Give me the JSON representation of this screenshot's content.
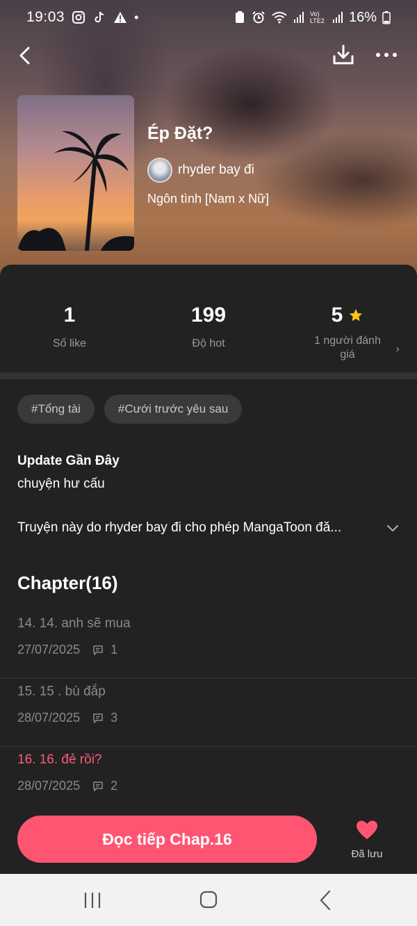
{
  "status_bar": {
    "time": "19:03",
    "battery": "16%",
    "network_label": "Vo) LTE2"
  },
  "book": {
    "title": "Ép Đặt?",
    "author": "rhyder bay đi",
    "genre": "Ngôn tình [Nam x Nữ]"
  },
  "stats": [
    {
      "value": "1",
      "label": "Số like"
    },
    {
      "value": "199",
      "label": "Độ hot"
    },
    {
      "value": "5",
      "label": "1 người đánh giá"
    }
  ],
  "tags": [
    "#Tổng tài",
    "#Cưới trước yêu sau"
  ],
  "update": {
    "title": "Update Gần Đây",
    "text": "chuyện hư cấu"
  },
  "description": "Truyện này do rhyder bay đi cho phép MangaToon đă...",
  "chapter_header": "Chapter(16)",
  "chapters": [
    {
      "title": "14. 14. anh sẽ mua",
      "date": "27/07/2025",
      "comments": "1"
    },
    {
      "title": "15. 15 . bù đắp",
      "date": "28/07/2025",
      "comments": "3"
    },
    {
      "title": "16. 16. đẻ rồi?",
      "date": "28/07/2025",
      "comments": "2"
    }
  ],
  "actions": {
    "read_label": "Đọc tiếp Chap.16",
    "save_label": "Đã lưu"
  },
  "colors": {
    "accent": "#ff5572",
    "current_chapter": "#ff5b79",
    "star": "#ffc21a"
  }
}
